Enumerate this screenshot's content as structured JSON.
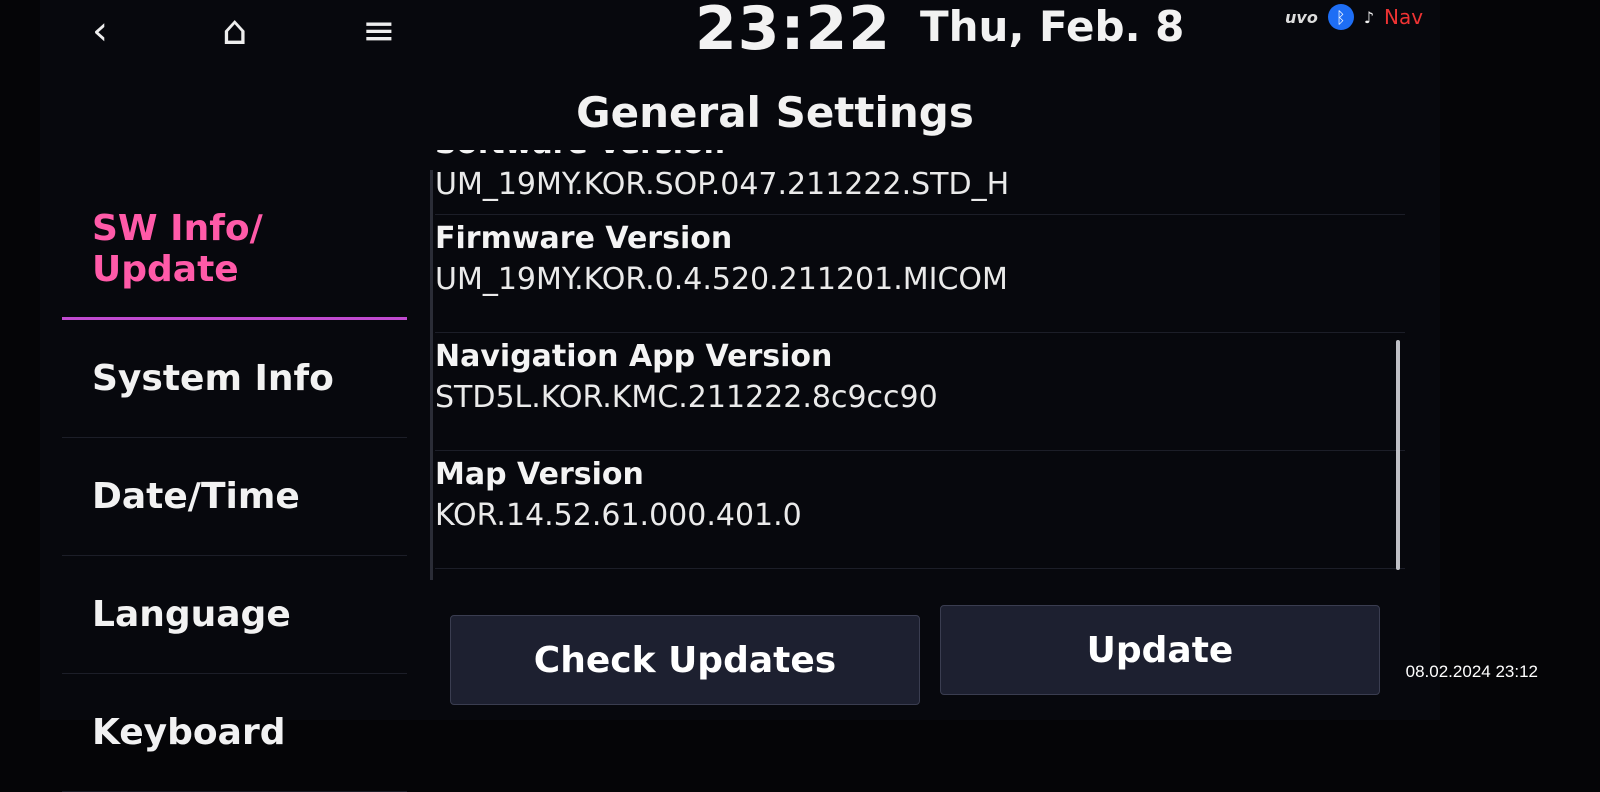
{
  "topbar": {
    "back_icon": "‹",
    "home_icon": "⌂",
    "menu_icon": "≡",
    "time": "23:22",
    "date": "Thu, Feb. 8",
    "uvo": "uvo",
    "bluetooth_icon": "ᛒ",
    "music_icon": "♪",
    "nav_off": "Nav"
  },
  "title": "General Settings",
  "sidebar": {
    "items": [
      {
        "label": "SW Info/\nUpdate"
      },
      {
        "label": "System Info"
      },
      {
        "label": "Date/Time"
      },
      {
        "label": "Language"
      },
      {
        "label": "Keyboard"
      }
    ]
  },
  "info": [
    {
      "label": "Software Version",
      "value": "UM_19MY.KOR.SOP.047.211222.STD_H"
    },
    {
      "label": "Firmware Version",
      "value": "UM_19MY.KOR.0.4.520.211201.MICOM"
    },
    {
      "label": "Navigation App Version",
      "value": "STD5L.KOR.KMC.211222.8c9cc90"
    },
    {
      "label": "Map Version",
      "value": "KOR.14.52.61.000.401.0"
    }
  ],
  "buttons": {
    "check_updates": "Check Updates",
    "update": "Update"
  },
  "photo_timestamp": "08.02.2024  23:12",
  "colors": {
    "accent": "#ff5aa8",
    "background": "#07080d"
  }
}
